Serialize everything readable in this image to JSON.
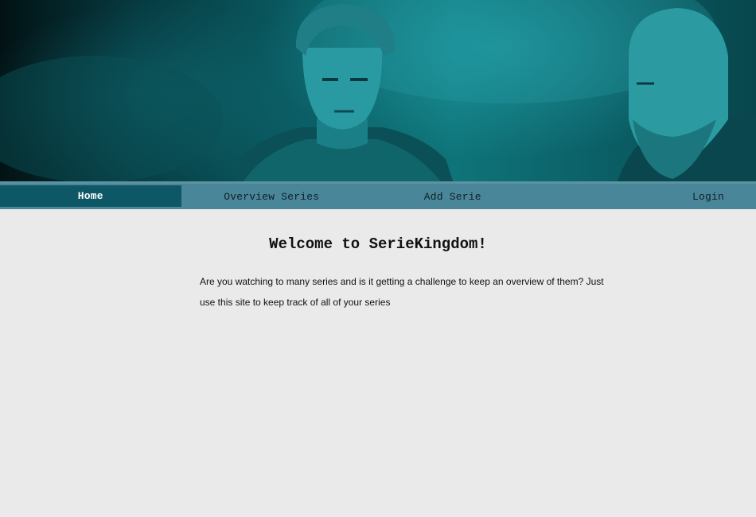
{
  "banner": {
    "image_description_icon": "banner-photo"
  },
  "nav": {
    "items": [
      {
        "label": "Home",
        "active": true
      },
      {
        "label": "Overview Series",
        "active": false
      },
      {
        "label": "Add Serie",
        "active": false
      },
      {
        "label": "Login",
        "active": false
      }
    ]
  },
  "main": {
    "title": "Welcome to SerieKingdom!",
    "intro": "Are you watching to many series and is it getting a challenge to keep an overview of them? Just use this site to keep track of all of your series"
  },
  "colors": {
    "nav_bg": "#4a8699",
    "nav_active": "#0e5766",
    "banner_tint": "#0e7479",
    "page_bg": "#eaeaea"
  }
}
